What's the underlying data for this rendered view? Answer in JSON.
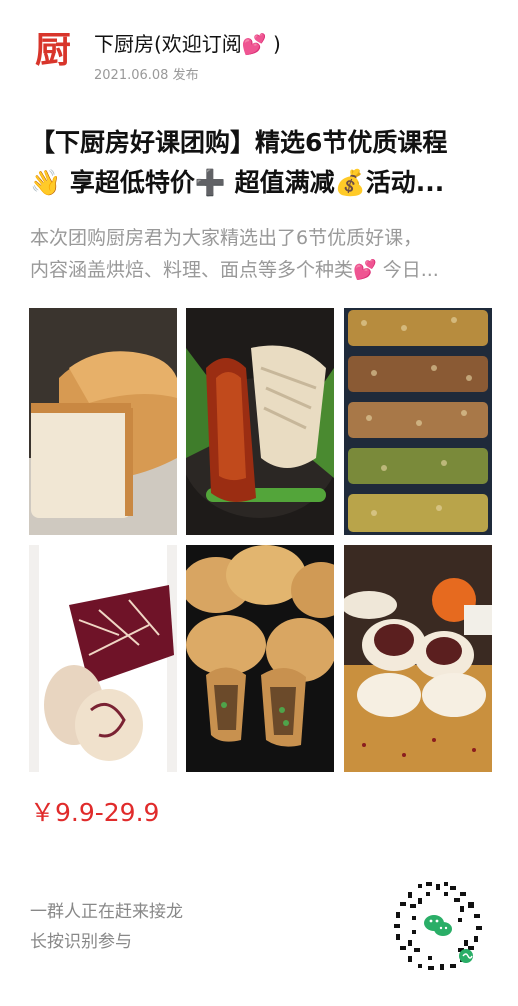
{
  "header": {
    "logo_char": "厨",
    "author": "下厨房(欢迎订阅💕 )",
    "date": "2021.06.08 发布"
  },
  "title": {
    "line1": "【下厨房好课团购】精选6节优质课程",
    "line2": "👋 享超低特价➕ 超值满减💰活动..."
  },
  "description": {
    "line1": "本次团购厨房君为大家精选出了6节优质好课，",
    "line2": "内容涵盖烘焙、料理、面点等多个种类💕 今日..."
  },
  "images": [
    {
      "name": "bread-loaf-image"
    },
    {
      "name": "roast-meat-image"
    },
    {
      "name": "granola-bars-image"
    },
    {
      "name": "marble-bread-image"
    },
    {
      "name": "meat-pies-image"
    },
    {
      "name": "red-bean-buns-image"
    }
  ],
  "price": "￥9.9-29.9",
  "cta": {
    "line1": "一群人正在赶来接龙",
    "line2": "长按识别参与"
  },
  "colors": {
    "brand_red": "#d8352b",
    "price_red": "#e02b2b",
    "wechat_green": "#2aae67"
  }
}
